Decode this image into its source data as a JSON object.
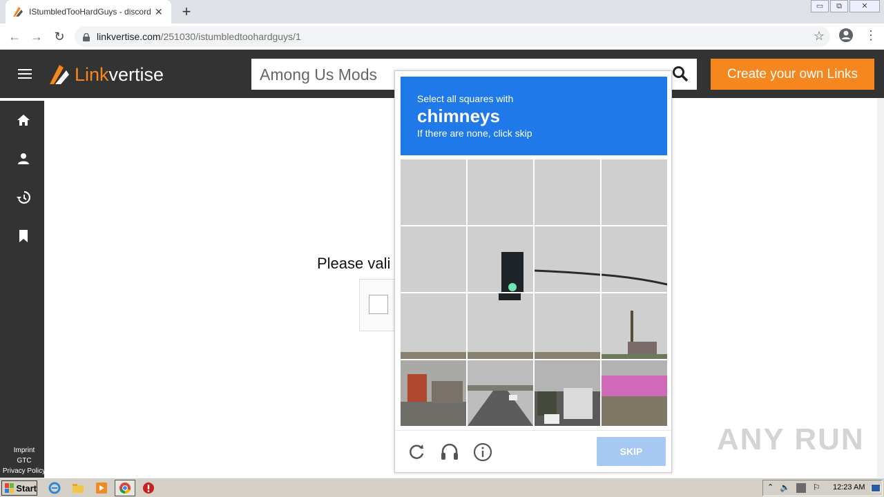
{
  "browser": {
    "tab_title": "IStumbledTooHardGuys - discord.gg",
    "tab_close": "✕",
    "new_tab": "+",
    "url_domain": "linkvertise.com",
    "url_path": "/251030/istumbledtoohardguys/1",
    "back": "←",
    "forward": "→",
    "reload": "↻",
    "star": "☆",
    "menu": "⋮",
    "win_min": "▭",
    "win_restore": "⧉",
    "win_close": "✕"
  },
  "header": {
    "logo_accent": "Link",
    "logo_rest": "vertise",
    "search_placeholder": "Among Us Mods",
    "cta_label": "Create your own Links"
  },
  "sidebar": {
    "footer": [
      "Imprint",
      "GTC",
      "Privacy Policy"
    ]
  },
  "main": {
    "validate_text": "Please vali"
  },
  "challenge": {
    "line1": "Select all squares with",
    "target": "chimneys",
    "line3": "If there are none, click skip",
    "skip_label": "SKIP"
  },
  "watermark": "ANY RUN",
  "taskbar": {
    "start_label": "Start",
    "clock": "12:23 AM"
  },
  "colors": {
    "accent_orange": "#f6871f",
    "header_bg": "#333333",
    "challenge_blue": "#1f79e8",
    "skip_disabled": "#a8c8f4"
  }
}
